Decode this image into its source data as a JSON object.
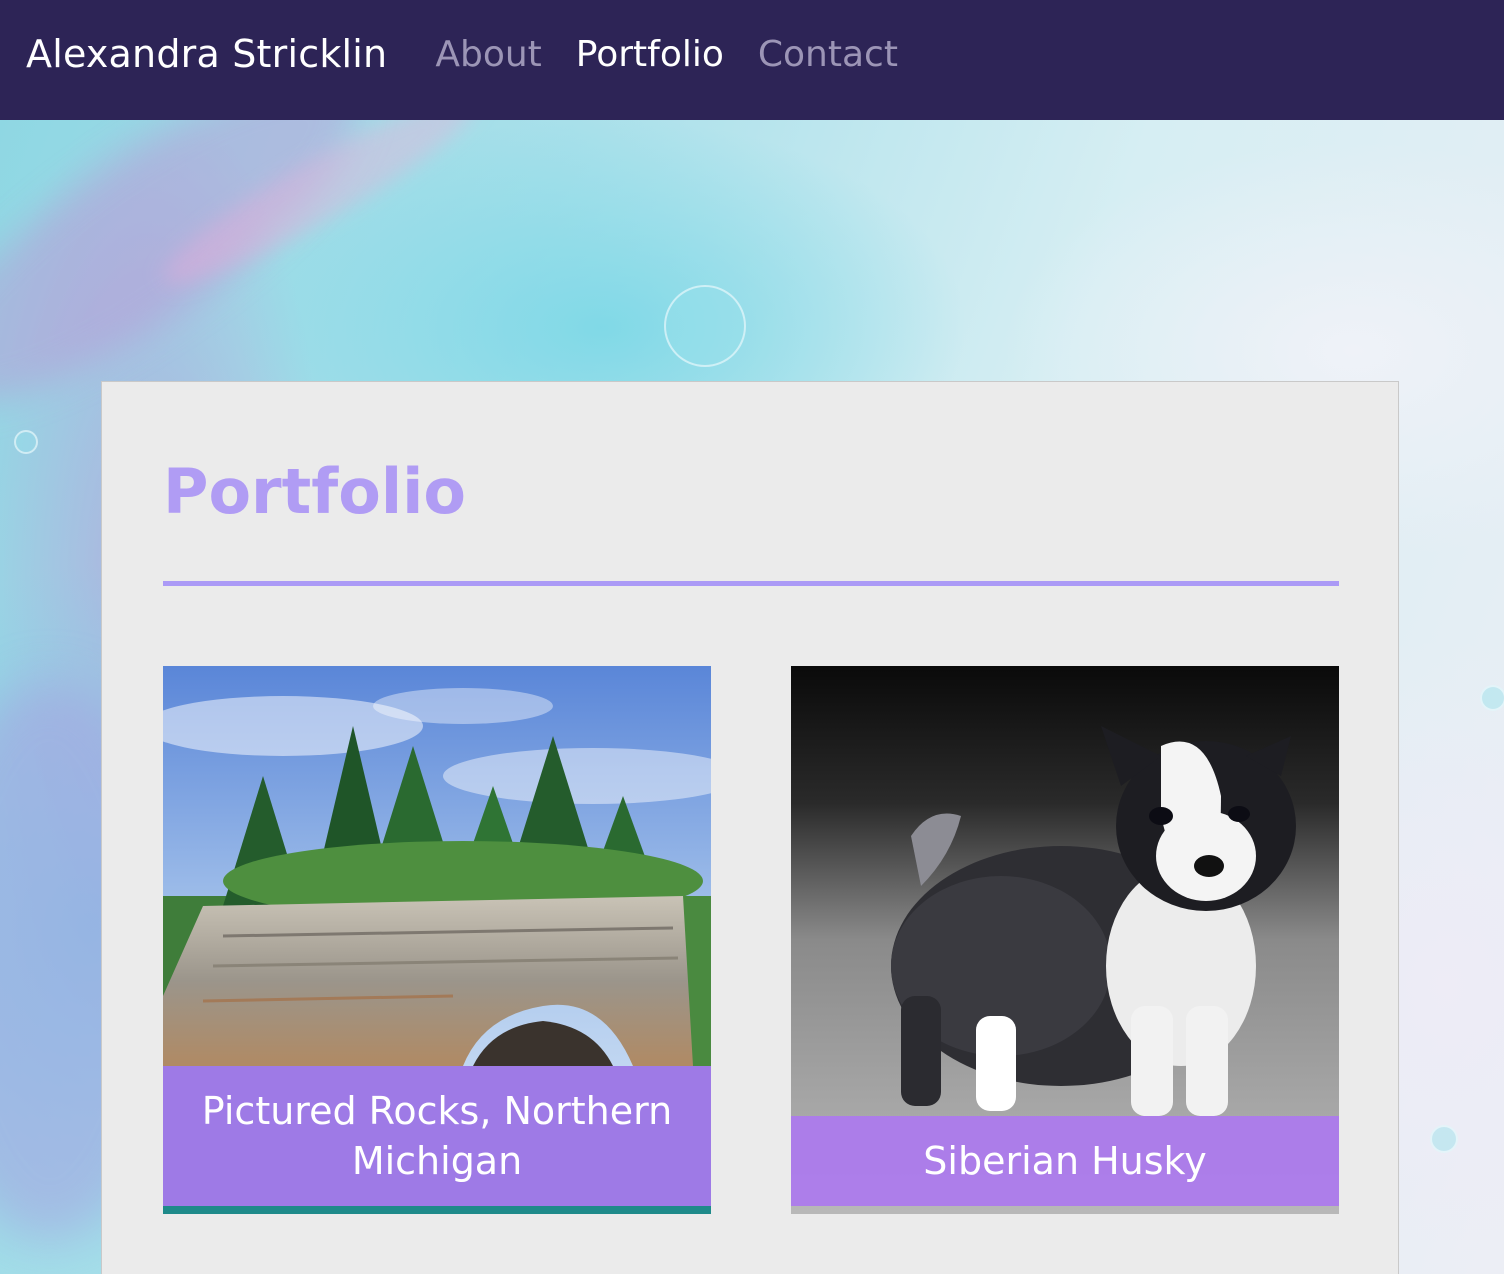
{
  "navbar": {
    "brand": "Alexandra Stricklin",
    "links": [
      {
        "label": "About",
        "active": false
      },
      {
        "label": "Portfolio",
        "active": true
      },
      {
        "label": "Contact",
        "active": false
      }
    ]
  },
  "main": {
    "title": "Portfolio",
    "items": [
      {
        "caption": "Pictured Rocks, Northern Michigan",
        "image": "pictured-rocks-photo"
      },
      {
        "caption": "Siberian Husky",
        "image": "husky-puppy-photo"
      }
    ]
  },
  "colors": {
    "navbar_bg": "#2d2456",
    "accent": "#b09cf4",
    "caption_bg": "#ac78f0",
    "card_bg": "#ebebeb"
  }
}
